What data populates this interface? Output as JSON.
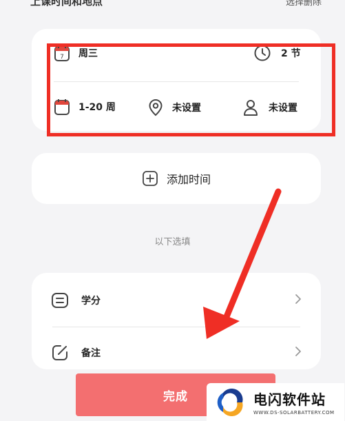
{
  "header": {
    "title": "上课时间和地点",
    "action": "选择删除"
  },
  "time_card": {
    "weekday": "周三",
    "sessions": "2 节",
    "weeks": "1-20 周",
    "location": "未设置",
    "teacher": "未设置"
  },
  "add_time_label": "添加时间",
  "optional_separator": "以下选填",
  "options": [
    {
      "label": "学分",
      "icon": "credit-list-icon"
    },
    {
      "label": "备注",
      "icon": "edit-note-icon"
    }
  ],
  "done_label": "完成",
  "watermark": {
    "title": "电闪软件站",
    "url": "WWW.DS-SOLARBATTERY.COM"
  },
  "colors": {
    "accent": "#f36f70",
    "annotation": "#ef2e25",
    "calendar_red": "#e0463c"
  }
}
